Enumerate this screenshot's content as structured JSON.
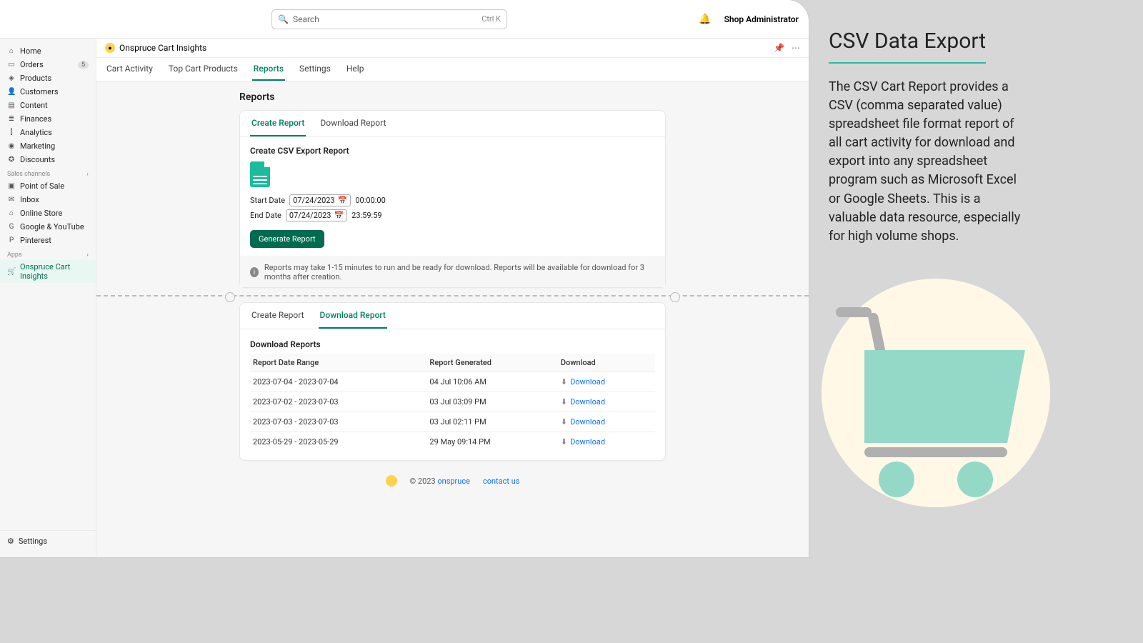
{
  "topbar": {
    "search_placeholder": "Search",
    "kbd": "Ctrl K",
    "user_label": "Shop Administrator"
  },
  "sidebar": {
    "main": [
      {
        "icon": "⌂",
        "label": "Home"
      },
      {
        "icon": "▭",
        "label": "Orders",
        "badge": "5"
      },
      {
        "icon": "◈",
        "label": "Products"
      },
      {
        "icon": "👤",
        "label": "Customers"
      },
      {
        "icon": "▤",
        "label": "Content"
      },
      {
        "icon": "≣",
        "label": "Finances"
      },
      {
        "icon": "⫿",
        "label": "Analytics"
      },
      {
        "icon": "◉",
        "label": "Marketing"
      },
      {
        "icon": "✪",
        "label": "Discounts"
      }
    ],
    "channels_heading": "Sales channels",
    "channels": [
      {
        "icon": "▣",
        "label": "Point of Sale"
      },
      {
        "icon": "✉",
        "label": "Inbox"
      },
      {
        "icon": "⌂",
        "label": "Online Store"
      },
      {
        "icon": "G",
        "label": "Google & YouTube"
      },
      {
        "icon": "P",
        "label": "Pinterest"
      }
    ],
    "apps_heading": "Apps",
    "apps": [
      {
        "icon": "🛒",
        "label": "Onspruce Cart Insights"
      }
    ],
    "settings": "Settings"
  },
  "app_header": {
    "title": "Onspruce Cart Insights"
  },
  "app_tabs": [
    "Cart Activity",
    "Top Cart Products",
    "Reports",
    "Settings",
    "Help"
  ],
  "app_tabs_active": "Reports",
  "page": {
    "title": "Reports"
  },
  "create_card": {
    "tabs": [
      "Create Report",
      "Download Report"
    ],
    "active": "Create Report",
    "heading": "Create CSV Export Report",
    "start_label": "Start Date",
    "start_date": "07/24/2023",
    "start_time": "00:00:00",
    "end_label": "End Date",
    "end_date": "07/24/2023",
    "end_time": "23:59:59",
    "button": "Generate Report",
    "note": "Reports may take 1-15 minutes to run and be ready for download. Reports will be available for download for 3 months after creation."
  },
  "download_card": {
    "tabs": [
      "Create Report",
      "Download Report"
    ],
    "active": "Download Report",
    "heading": "Download Reports",
    "columns": [
      "Report Date Range",
      "Report Generated",
      "Download"
    ],
    "rows": [
      {
        "range": "2023-07-04 - 2023-07-04",
        "gen": "04 Jul 10:06 AM",
        "link": "Download"
      },
      {
        "range": "2023-07-02 - 2023-07-03",
        "gen": "03 Jul 03:09 PM",
        "link": "Download"
      },
      {
        "range": "2023-07-03 - 2023-07-03",
        "gen": "03 Jul 02:11 PM",
        "link": "Download"
      },
      {
        "range": "2023-05-29 - 2023-05-29",
        "gen": "29 May 09:14 PM",
        "link": "Download"
      }
    ]
  },
  "footer": {
    "copyright": "© 2023",
    "brand": "onspruce",
    "contact": "contact us"
  },
  "marketing": {
    "title": "CSV Data Export",
    "body": "The CSV Cart Report provides a CSV (comma separated value) spreadsheet file format report of all cart activity for download and export into any spreadsheet program such as Microsoft Excel or Google Sheets.  This is a valuable data resource, especially for high volume shops."
  }
}
